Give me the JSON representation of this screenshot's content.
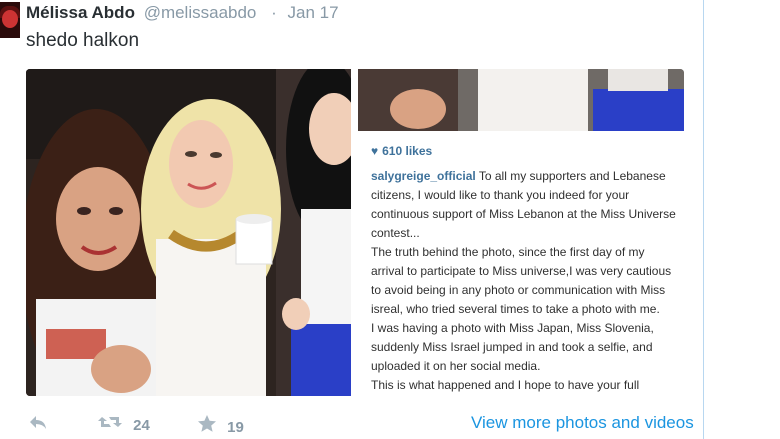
{
  "tweet": {
    "author_name": "Mélissa Abdo",
    "author_handle": "@melissaabdo",
    "separator": "·",
    "date": "Jan 17",
    "text": "shedo halkon"
  },
  "instagram": {
    "likes_text": "610 likes",
    "username": "salygreige_official",
    "caption_lines": [
      "To all my supporters and Lebanese citizens, I would like to thank you indeed for your continuous support of Miss Lebanon at the Miss Universe contest...",
      "The truth behind the photo, since the first day of my arrival to participate to Miss universe,I was very cautious to avoid being in any photo or communication with Miss isreal, who tried several times to take a photo with me.",
      "I was having a photo with Miss Japan, Miss Slovenia, suddenly Miss Israel jumped in and took a selfie, and uploaded it on her social media.",
      "This is what happened and I hope to have your full"
    ]
  },
  "actions": {
    "reply_icon": "reply-icon",
    "retweet_icon": "retweet-icon",
    "retweet_count": "24",
    "favorite_icon": "star-icon",
    "favorite_count": "19",
    "view_more": "View more photos and videos"
  },
  "colors": {
    "link": "#1b95e0",
    "instagram_blue": "#3f729b",
    "muted": "#8899a6"
  }
}
